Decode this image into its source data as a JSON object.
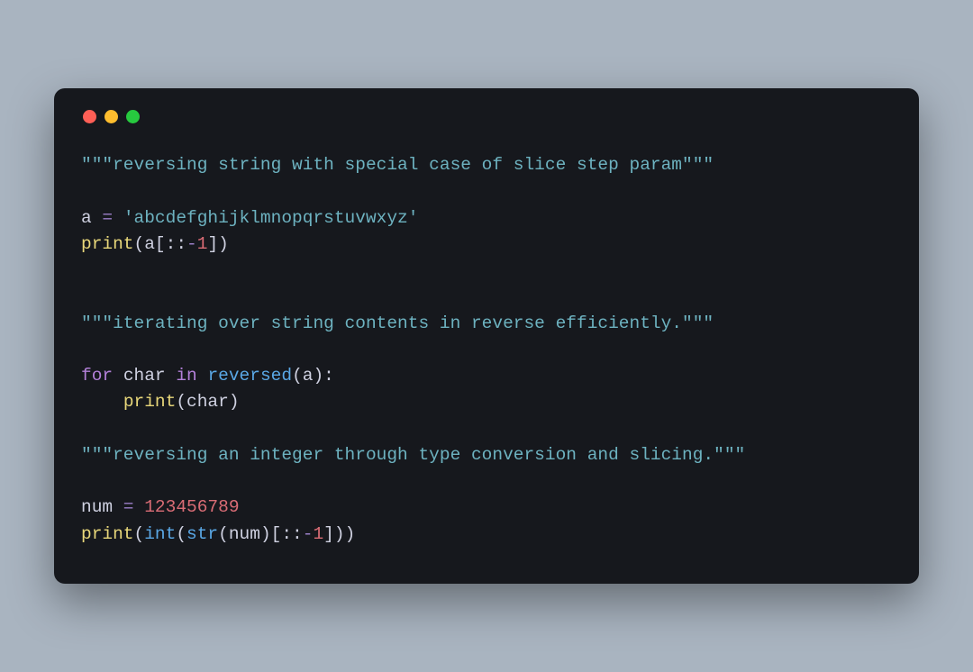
{
  "window": {
    "traffic_lights": [
      "close",
      "minimize",
      "maximize"
    ]
  },
  "code": {
    "line1": {
      "docstring": "\"\"\"reversing string with special case of slice step param\"\"\""
    },
    "blank1": "",
    "line2": {
      "var": "a",
      "eq": " = ",
      "str": "'abcdefghijklmnopqrstuvwxyz'"
    },
    "line3": {
      "print": "print",
      "open": "(",
      "var": "a",
      "lbrack": "[",
      "slice": "::",
      "minus": "-",
      "one": "1",
      "rbrack": "]",
      "close": ")"
    },
    "blank2": "",
    "blank3": "",
    "line4": {
      "docstring": "\"\"\"iterating over string contents in reverse efficiently.\"\"\""
    },
    "blank4": "",
    "line5": {
      "for": "for",
      "sp1": " ",
      "char": "char",
      "sp2": " ",
      "in": "in",
      "sp3": " ",
      "reversed": "reversed",
      "open": "(",
      "var": "a",
      "close": ")",
      "colon": ":"
    },
    "line6": {
      "indent": "    ",
      "print": "print",
      "open": "(",
      "char": "char",
      "close": ")"
    },
    "blank5": "",
    "line7": {
      "docstring": "\"\"\"reversing an integer through type conversion and slicing.\"\"\""
    },
    "blank6": "",
    "line8": {
      "var": "num",
      "eq": " = ",
      "num": "123456789"
    },
    "line9": {
      "print": "print",
      "o1": "(",
      "int": "int",
      "o2": "(",
      "str": "str",
      "o3": "(",
      "var": "num",
      "c3": ")",
      "lbrack": "[",
      "slice": "::",
      "minus": "-",
      "one": "1",
      "rbrack": "]",
      "c2": ")",
      "c1": ")"
    }
  }
}
